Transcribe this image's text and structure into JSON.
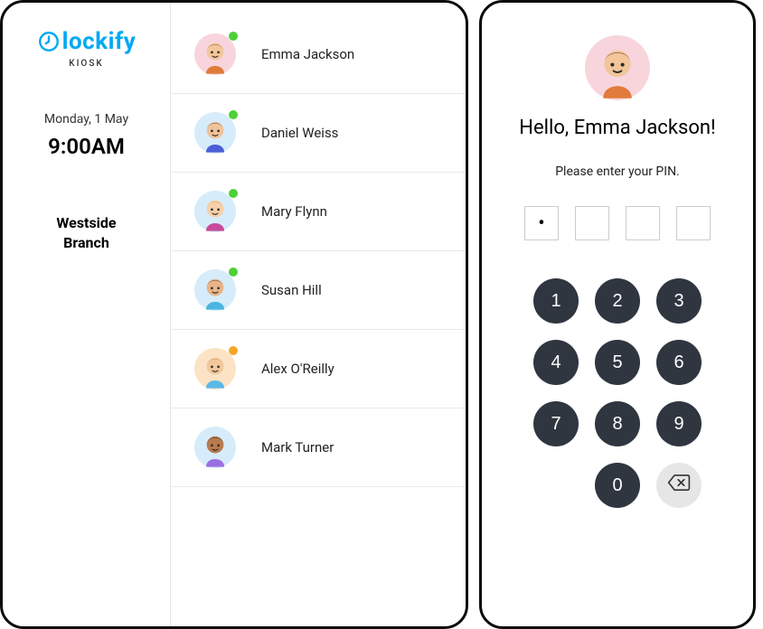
{
  "brand": {
    "name": "lockify",
    "sub": "KIOSK"
  },
  "sidebar": {
    "date": "Monday, 1 May",
    "time": "9:00AM",
    "branch_line1": "Westside",
    "branch_line2": "Branch"
  },
  "users": [
    {
      "name": "Emma Jackson",
      "status": "green",
      "avatar_bg": "#F8D5DC",
      "hair": "#6E3B2A",
      "skin": "#F3C59B",
      "shirt": "#E07B3C"
    },
    {
      "name": "Daniel Weiss",
      "status": "green",
      "avatar_bg": "#D6ECFA",
      "hair": "#3B2A1E",
      "skin": "#F0C39A",
      "shirt": "#4C5FD7"
    },
    {
      "name": "Mary Flynn",
      "status": "green",
      "avatar_bg": "#D6ECFA",
      "hair": "#E88A3A",
      "skin": "#F6D0A8",
      "shirt": "#C74A9B"
    },
    {
      "name": "Susan Hill",
      "status": "green",
      "avatar_bg": "#D6ECFA",
      "hair": "#3B2618",
      "skin": "#E8B488",
      "shirt": "#49B5E0"
    },
    {
      "name": "Alex O'Reilly",
      "status": "orange",
      "avatar_bg": "#FCE3C5",
      "hair": "#D98C4A",
      "skin": "#F2C79C",
      "shirt": "#5BB8E8"
    },
    {
      "name": "Mark Turner",
      "status": "none",
      "avatar_bg": "#D6ECFA",
      "hair": "#2A1E16",
      "skin": "#B87A4F",
      "shirt": "#9A6FE0"
    }
  ],
  "pin_panel": {
    "selected_user": "Emma Jackson",
    "greeting_prefix": "Hello, ",
    "greeting_suffix": "!",
    "greeting_full": "Hello, Emma Jackson!",
    "instruction": "Please enter your PIN.",
    "entered_count": 1,
    "length": 4,
    "avatar": {
      "bg": "#F8D5DC",
      "hair": "#6E3B2A",
      "skin": "#F3C59B",
      "shirt": "#E07B3C"
    }
  },
  "keypad": {
    "keys": [
      "1",
      "2",
      "3",
      "4",
      "5",
      "6",
      "7",
      "8",
      "9",
      "0"
    ],
    "backspace": "backspace"
  }
}
